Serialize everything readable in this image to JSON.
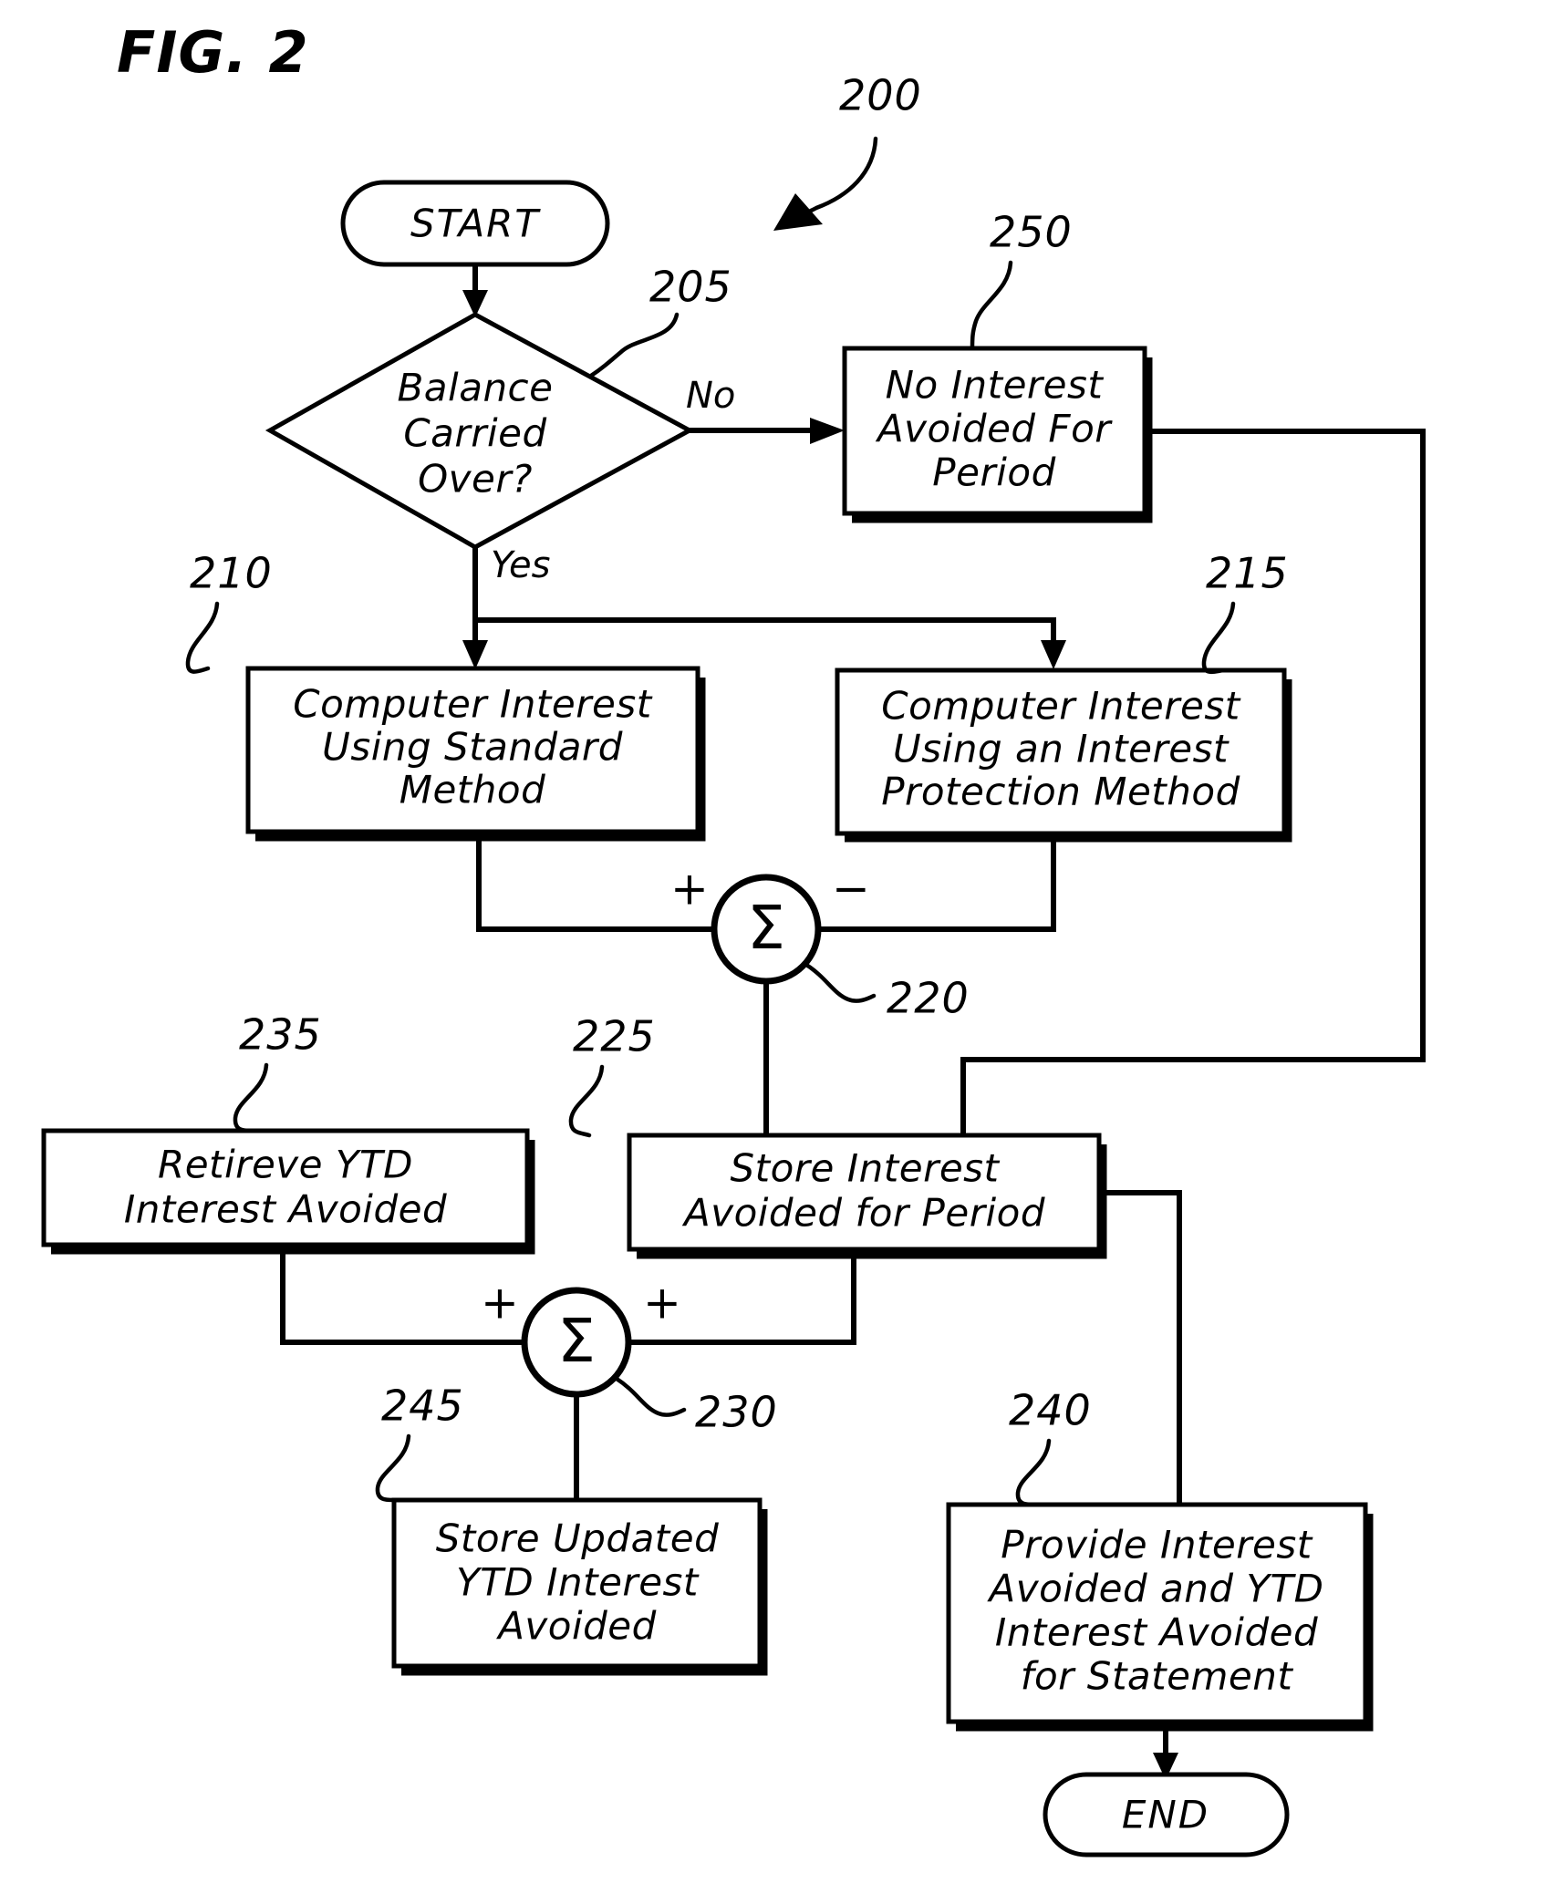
{
  "figure": {
    "title": "FIG. 2",
    "diagram_ref": "200"
  },
  "nodes": {
    "start": {
      "label": "START",
      "type": "terminator"
    },
    "decision_205": {
      "ref": "205",
      "line1": "Balance",
      "line2": "Carried",
      "line3": "Over?",
      "type": "decision"
    },
    "box_250": {
      "ref": "250",
      "line1": "No Interest",
      "line2": "Avoided For",
      "line3": "Period",
      "type": "process"
    },
    "box_210": {
      "ref": "210",
      "line1": "Computer Interest",
      "line2": "Using Standard",
      "line3": "Method",
      "type": "process"
    },
    "box_215": {
      "ref": "215",
      "line1": "Computer Interest",
      "line2": "Using an Interest",
      "line3": "Protection Method",
      "type": "process"
    },
    "sum_220": {
      "ref": "220",
      "symbol": "Σ",
      "sign_left": "+",
      "sign_right": "−",
      "type": "summation"
    },
    "box_225": {
      "ref": "225",
      "line1": "Store Interest",
      "line2": "Avoided for Period",
      "type": "process"
    },
    "box_235": {
      "ref": "235",
      "line1": "Retireve YTD",
      "line2": "Interest Avoided",
      "type": "process"
    },
    "sum_230": {
      "ref": "230",
      "symbol": "Σ",
      "sign_left": "+",
      "sign_right": "+",
      "type": "summation"
    },
    "box_245": {
      "ref": "245",
      "line1": "Store Updated",
      "line2": "YTD Interest",
      "line3": "Avoided",
      "type": "process"
    },
    "box_240": {
      "ref": "240",
      "line1": "Provide Interest",
      "line2": "Avoided and YTD",
      "line3": "Interest Avoided",
      "line4": "for Statement",
      "type": "process"
    },
    "end": {
      "label": "END",
      "type": "terminator"
    }
  },
  "edges": {
    "no_label": "No",
    "yes_label": "Yes"
  },
  "colors": {
    "ink": "#000000",
    "paper": "#ffffff"
  }
}
